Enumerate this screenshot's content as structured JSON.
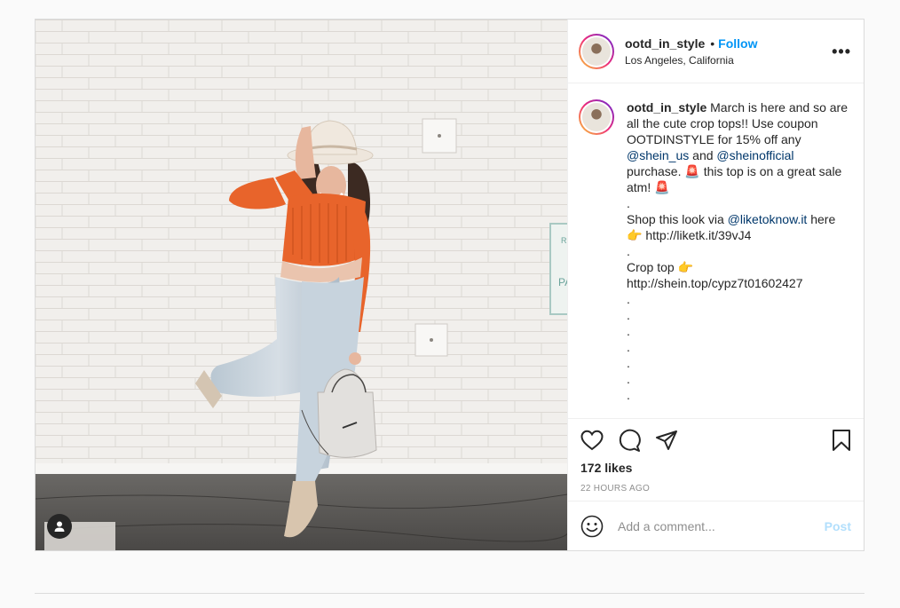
{
  "post": {
    "username": "ootd_in_style",
    "follow_label": "Follow",
    "separator": "•",
    "location": "Los Angeles, California",
    "more_icon": "more-options-icon",
    "more_label": "•••",
    "caption": {
      "username": "ootd_in_style",
      "segments": [
        {
          "text": " March is here and so are all the cute crop tops!! Use coupon OOTDINSTYLE for 15% off any "
        },
        {
          "text": "@shein_us",
          "mention": true
        },
        {
          "text": " and "
        },
        {
          "text": "@sheinofficial",
          "mention": true
        },
        {
          "text": " purchase. 🚨 this top is on a great sale atm! 🚨\n.\nShop this look via "
        },
        {
          "text": "@liketoknow.it",
          "mention": true
        },
        {
          "text": " here\n👉 http://liketk.it/39vJ4\n.\nCrop top 👉\nhttp://shein.top/cypz7t01602427\n.\n.\n.\n.\n.\n.\n."
        }
      ]
    },
    "actions": {
      "like_icon": "heart-icon",
      "comment_icon": "comment-icon",
      "share_icon": "share-icon",
      "save_icon": "bookmark-icon"
    },
    "likes": "172 likes",
    "timestamp": "22 HOURS AGO",
    "comment_box": {
      "emoji_icon": "emoji-icon",
      "placeholder": "Add a comment...",
      "post_label": "Post"
    },
    "tag_icon": "user-tag-icon"
  },
  "colors": {
    "accent": "#0095f6",
    "mention": "#00376b",
    "post_disabled": "#b2dffc",
    "muted": "#8e8e8e",
    "top_color": "#e8642b"
  }
}
